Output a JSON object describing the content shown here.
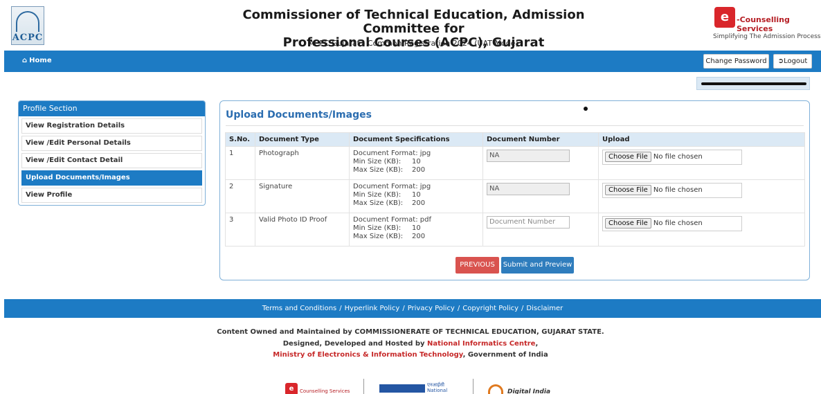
{
  "header": {
    "logo_text": "ACPC",
    "title_line1": "Commissioner of Technical Education, Admission Committee for",
    "title_line2": "Professional Courses (ACPC), Gujarat",
    "subtitle": "ACPC Gujarat - Common Registration 2024 (UAT Mode)",
    "ec_logo_letter": "e",
    "ec_name": "-Counselling Services",
    "ec_tagline": "Simplifying The Admission Process"
  },
  "nav": {
    "home_label": "Home",
    "change_password_label": "Change Password",
    "logout_label": "Logout"
  },
  "sidebar": {
    "heading": "Profile Section",
    "items": [
      {
        "label": "View Registration Details",
        "active": false
      },
      {
        "label": "View /Edit Personal Details",
        "active": false
      },
      {
        "label": "View /Edit Contact Detail",
        "active": false
      },
      {
        "label": "Upload Documents/Images",
        "active": true
      },
      {
        "label": "View Profile",
        "active": false
      }
    ]
  },
  "main": {
    "title": "Upload Documents/Images",
    "columns": [
      "S.No.",
      "Document Type",
      "Document Specifications",
      "Document Number",
      "Upload"
    ],
    "rows": [
      {
        "sno": "1",
        "type": "Photograph",
        "format": "Document Format: jpg",
        "min_label": "Min Size (KB):",
        "min": "10",
        "max_label": "Max Size (KB):",
        "max": "200",
        "doc_number_value": "NA",
        "doc_number_placeholder": "",
        "choose_label": "Choose File",
        "file_status": "No file chosen"
      },
      {
        "sno": "2",
        "type": "Signature",
        "format": "Document Format: jpg",
        "min_label": "Min Size (KB):",
        "min": "10",
        "max_label": "Max Size (KB):",
        "max": "200",
        "doc_number_value": "NA",
        "doc_number_placeholder": "",
        "choose_label": "Choose File",
        "file_status": "No file chosen"
      },
      {
        "sno": "3",
        "type": "Valid Photo ID Proof",
        "format": "Document Format: pdf",
        "min_label": "Min Size (KB):",
        "min": "10",
        "max_label": "Max Size (KB):",
        "max": "200",
        "doc_number_value": "",
        "doc_number_placeholder": "Document Number",
        "choose_label": "Choose File",
        "file_status": "No file chosen"
      }
    ],
    "previous_label": "PREVIOUS",
    "submit_label": "Submit and Preview"
  },
  "footer": {
    "links": [
      "Terms and Conditions",
      "Hyperlink Policy",
      "Privacy Policy",
      "Copyright Policy",
      "Disclaimer"
    ],
    "separator": "/",
    "line1": "Content Owned and Maintained by COMMISSIONERATE OF TECHNICAL EDUCATION, GUJARAT STATE.",
    "line2_prefix": "Designed, Developed and Hosted by ",
    "line2_link": "National Informatics Centre",
    "line2_suffix": ",",
    "line3_link": "Ministry of Electronics & Information Technology",
    "line3_suffix": ", Government of India",
    "logo_ec_text": "Counselling Services",
    "logo_nic_hindi": "एनआईसी",
    "logo_nic_text": "National",
    "logo_di_text": "Digital India"
  },
  "colors": {
    "primary_blue": "#1d7bc4",
    "previous_red": "#d9534f",
    "submit_blue": "#2f7dbd",
    "title_blue": "#2b6db0"
  }
}
